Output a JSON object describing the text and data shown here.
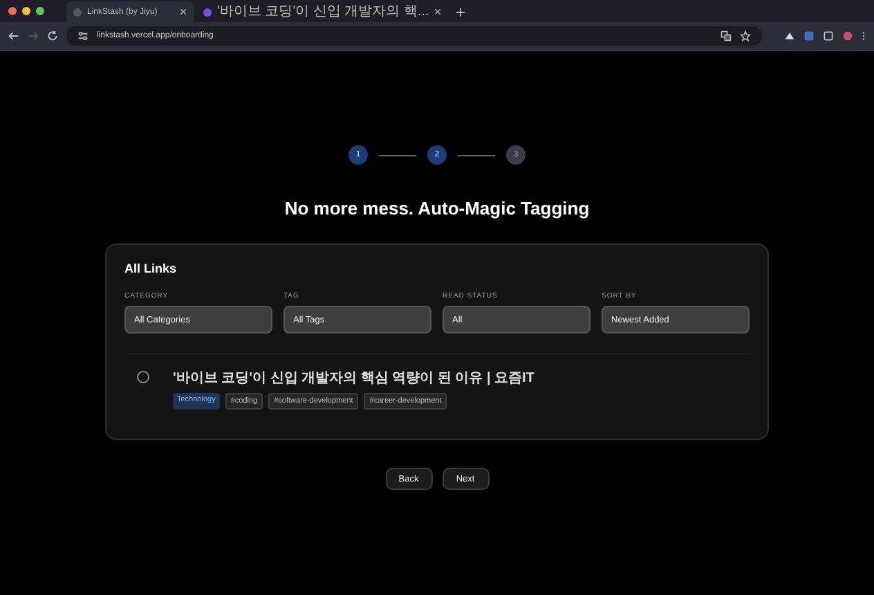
{
  "browser": {
    "tabs": [
      {
        "title": "LinkStash (by Jiyu)",
        "selected": true
      },
      {
        "title": "'바이브 코딩'이 신입 개발자의 핵...",
        "selected": false
      }
    ],
    "url": "linkstash.vercel.app/onboarding"
  },
  "steps": [
    {
      "label": "1",
      "done": true
    },
    {
      "label": "2",
      "done": true
    },
    {
      "label": "3",
      "done": false
    }
  ],
  "heading": "No more mess. Auto-Magic Tagging",
  "card": {
    "title": "All Links",
    "filters": [
      {
        "label": "CATEGORY",
        "value": "All Categories"
      },
      {
        "label": "TAG",
        "value": "All Tags"
      },
      {
        "label": "READ STATUS",
        "value": "All"
      },
      {
        "label": "SORT BY",
        "value": "Newest Added"
      }
    ],
    "links": [
      {
        "title": "'바이브 코딩'이 신입 개발자의 핵심 역량이 된 이유 | 요즘IT",
        "read": false,
        "category": "Technology",
        "tags": [
          "#coding",
          "#software-development",
          "#career-development"
        ]
      }
    ]
  },
  "buttons": [
    "Back",
    "Next"
  ]
}
